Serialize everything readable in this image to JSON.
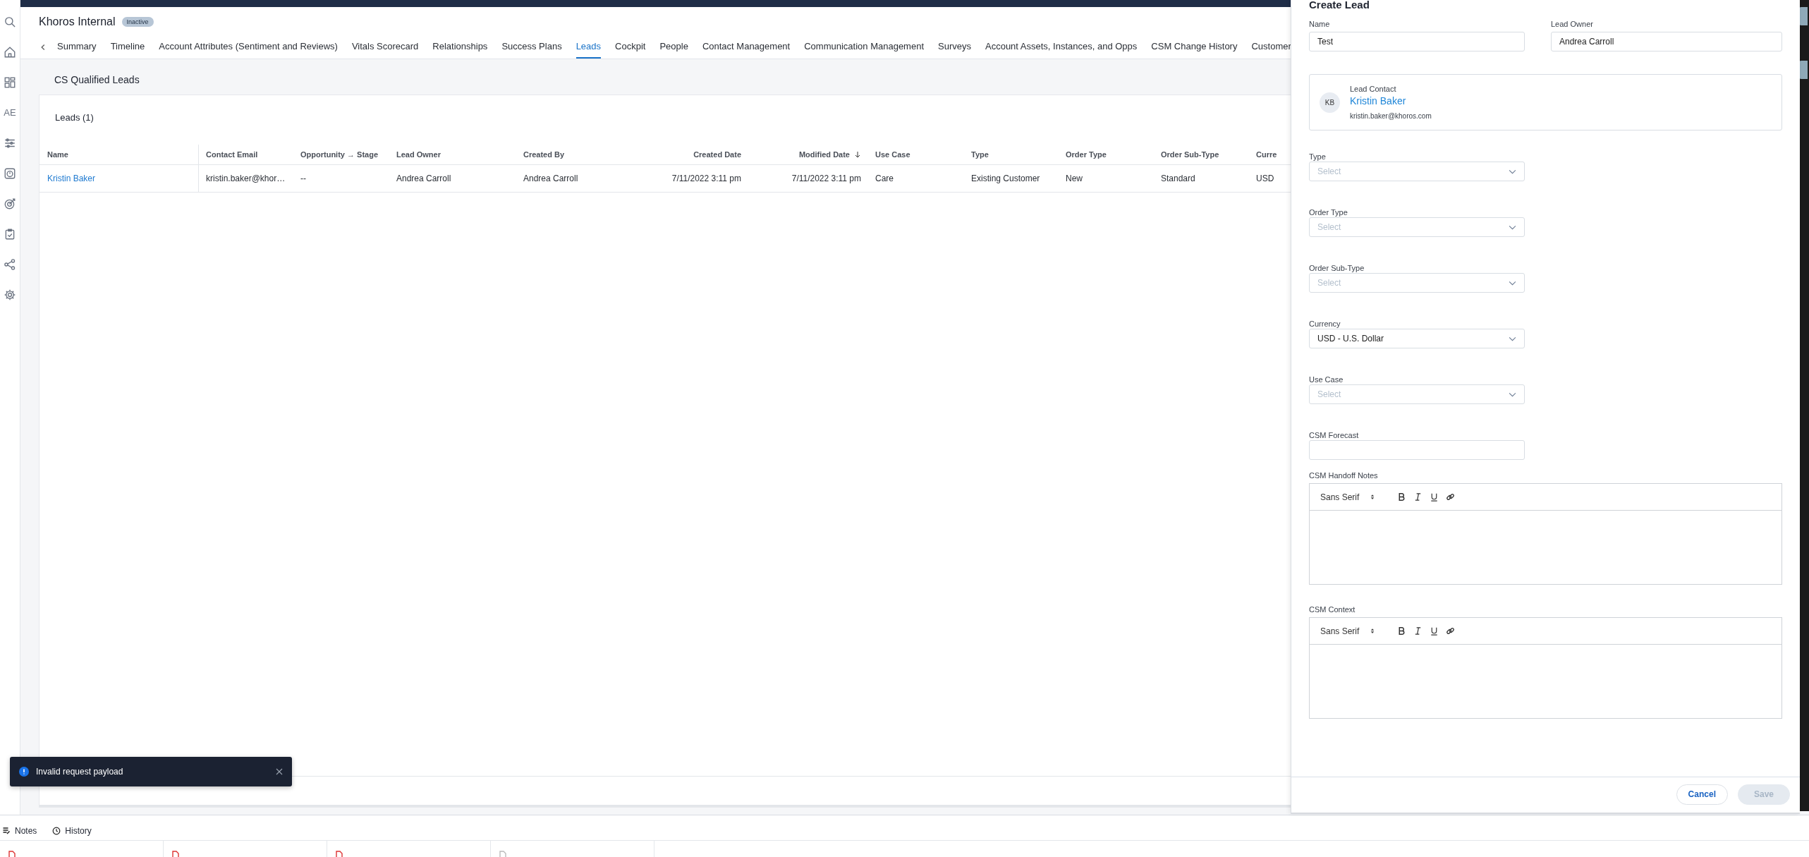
{
  "sidebar": {
    "label": "AE"
  },
  "header": {
    "title": "Khoros Internal",
    "badge": "Inactive"
  },
  "tabs": [
    {
      "label": "Summary",
      "selected": false
    },
    {
      "label": "Timeline",
      "selected": false
    },
    {
      "label": "Account Attributes (Sentiment and Reviews)",
      "selected": false
    },
    {
      "label": "Vitals Scorecard",
      "selected": false
    },
    {
      "label": "Relationships",
      "selected": false
    },
    {
      "label": "Success Plans",
      "selected": false
    },
    {
      "label": "Leads",
      "selected": true
    },
    {
      "label": "Cockpit",
      "selected": false
    },
    {
      "label": "People",
      "selected": false
    },
    {
      "label": "Contact Management",
      "selected": false
    },
    {
      "label": "Communication Management",
      "selected": false
    },
    {
      "label": "Surveys",
      "selected": false
    },
    {
      "label": "Account Assets, Instances, and Opps",
      "selected": false
    },
    {
      "label": "CSM Change History",
      "selected": false
    },
    {
      "label": "Customer",
      "selected": false
    }
  ],
  "section_title": "CS Qualified Leads",
  "table": {
    "title": "Leads (1)",
    "columns": [
      {
        "label": "Name"
      },
      {
        "label": "Contact Email"
      },
      {
        "label": "Opportunity → Stage"
      },
      {
        "label": "Lead Owner"
      },
      {
        "label": "Created By"
      },
      {
        "label": "Created Date"
      },
      {
        "label": "Modified Date",
        "sorted": true
      },
      {
        "label": "Use Case"
      },
      {
        "label": "Type"
      },
      {
        "label": "Order Type"
      },
      {
        "label": "Order Sub-Type"
      },
      {
        "label": "Curre"
      }
    ],
    "rows": [
      {
        "cells": [
          {
            "text": "Kristin Baker",
            "kind": "link"
          },
          {
            "text": "kristin.baker@khor…",
            "kind": "text"
          },
          {
            "text": "--",
            "kind": "text"
          },
          {
            "text": "Andrea Carroll",
            "kind": "text"
          },
          {
            "text": "Andrea Carroll",
            "kind": "text"
          },
          {
            "text": "7/11/2022 3:11 pm",
            "kind": "text"
          },
          {
            "text": "7/11/2022 3:11 pm",
            "kind": "text"
          },
          {
            "text": "Care",
            "kind": "text"
          },
          {
            "text": "Existing Customer",
            "kind": "text"
          },
          {
            "text": "New",
            "kind": "text"
          },
          {
            "text": "Standard",
            "kind": "text"
          },
          {
            "text": "USD",
            "kind": "text"
          }
        ]
      }
    ]
  },
  "toast": {
    "message": "Invalid request payload"
  },
  "bottom_bar": {
    "tabs": [
      {
        "label": "Notes"
      },
      {
        "label": "History"
      }
    ]
  },
  "panel": {
    "title": "Create Lead",
    "top_fields": [
      {
        "label": "Name",
        "value": "Test"
      },
      {
        "label": "Lead Owner",
        "value": "Andrea Carroll"
      }
    ],
    "lead_contact": {
      "label": "Lead Contact",
      "initials": "KB",
      "name": "Kristin Baker",
      "email": "kristin.baker@khoros.com"
    },
    "fields": [
      {
        "label": "Type",
        "kind": "select",
        "placeholder": "Select"
      },
      {
        "label": "Order Type",
        "kind": "select",
        "placeholder": "Select"
      },
      {
        "label": "Order Sub-Type",
        "kind": "select",
        "placeholder": "Select"
      },
      {
        "label": "Currency",
        "kind": "select",
        "value": "USD - U.S. Dollar"
      },
      {
        "label": "Use Case",
        "kind": "select",
        "placeholder": "Select"
      },
      {
        "label": "CSM Forecast",
        "kind": "text"
      },
      {
        "label": "CSM Handoff Notes",
        "kind": "editor",
        "font": "Sans Serif"
      },
      {
        "label": "CSM Context",
        "kind": "editor",
        "font": "Sans Serif"
      }
    ],
    "buttons": [
      {
        "label": "Cancel",
        "disabled": false
      },
      {
        "label": "Save",
        "disabled": true
      }
    ]
  }
}
